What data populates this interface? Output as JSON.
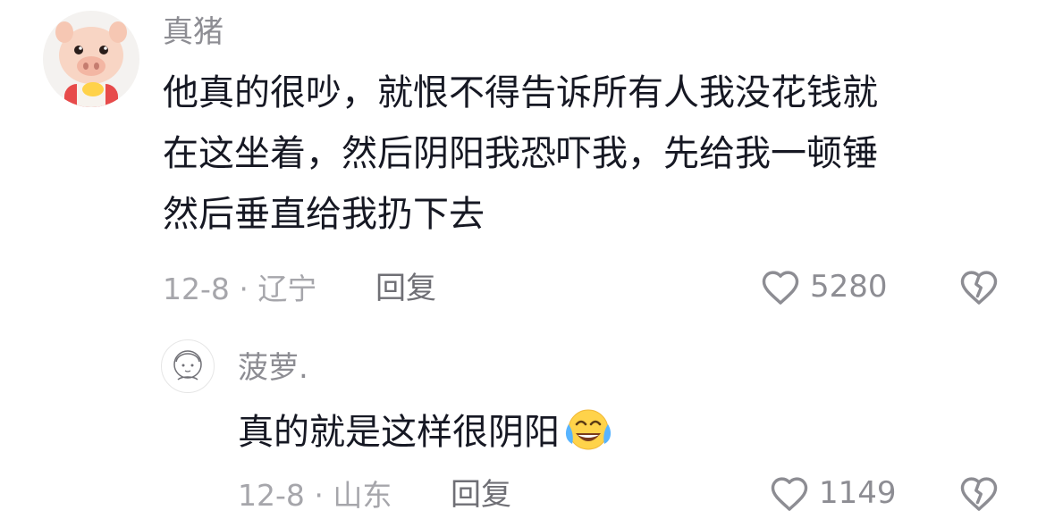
{
  "comments": [
    {
      "username": "真猪",
      "text_lines": [
        "他真的很吵，就恨不得告诉所有人我没花钱就",
        "在这坐着，然后阴阳我恐吓我，先给我一顿锤",
        "然后垂直给我扔下去"
      ],
      "meta": "12-8 · 辽宁",
      "reply_label": "回复",
      "likes": "5280"
    },
    {
      "username": "菠萝.",
      "text": "真的就是这样很阴阳",
      "emoji": "crying-laughing-emoji",
      "meta": "12-8 · 山东",
      "reply_label": "回复",
      "likes": "1149"
    }
  ],
  "colors": {
    "text": "#161823",
    "secondary": "#8d8d93",
    "muted": "#a6a6ab"
  }
}
